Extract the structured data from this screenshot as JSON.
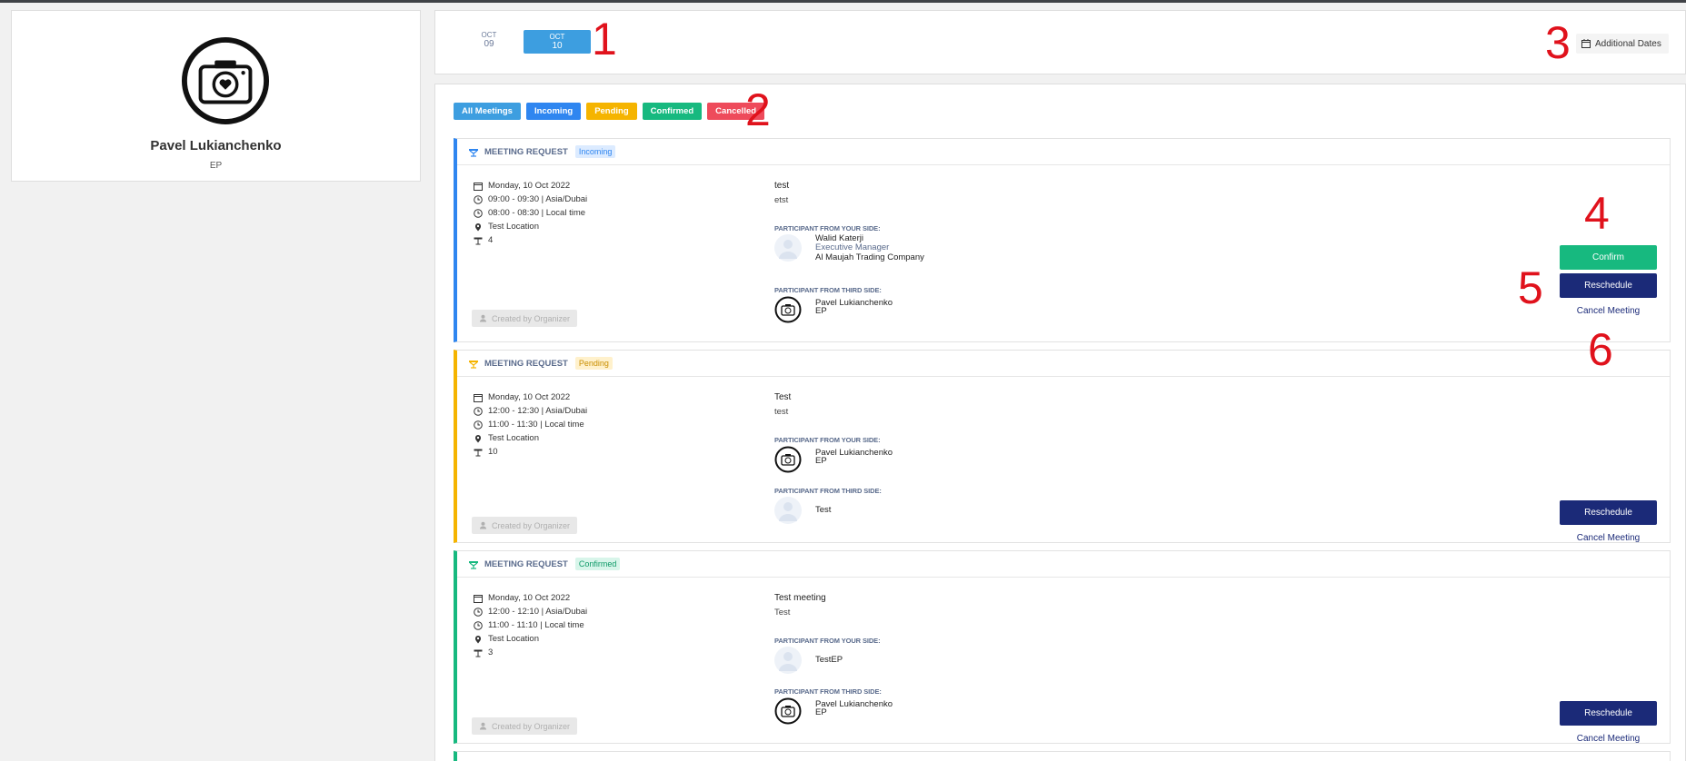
{
  "profile": {
    "name": "Pavel Lukianchenko",
    "role": "EP",
    "avatar_icon": "camera-heart-icon"
  },
  "dates": [
    {
      "month": "OCT",
      "day": "09",
      "selected": false
    },
    {
      "month": "OCT",
      "day": "10",
      "selected": true
    }
  ],
  "additional_dates_label": "Additional Dates",
  "annotations": [
    "1",
    "2",
    "3",
    "4",
    "5",
    "6"
  ],
  "filters": [
    {
      "label": "All Meetings",
      "color": "#3d9ee0"
    },
    {
      "label": "Incoming",
      "color": "#2f86f0"
    },
    {
      "label": "Pending",
      "color": "#f5b400"
    },
    {
      "label": "Confirmed",
      "color": "#17b97f"
    },
    {
      "label": "Cancelled",
      "color": "#ee4b5b"
    }
  ],
  "meetings": [
    {
      "title": "MEETING REQUEST",
      "status": "Incoming",
      "accent": "#2f86f0",
      "date": "Monday, 10 Oct 2022",
      "time_tz": "09:00 - 09:30 | Asia/Dubai",
      "time_local": "08:00 - 08:30 | Local time",
      "location": "Test Location",
      "table": "4",
      "subject": "test",
      "description": "etst",
      "your_side_label": "PARTICIPANT FROM YOUR SIDE:",
      "your_side": {
        "name": "Walid Katerji",
        "role": "Executive Manager",
        "company": "Al Maujah Trading Company"
      },
      "third_side_label": "PARTICIPANT FROM THIRD SIDE:",
      "third_side": {
        "name": "Pavel Lukianchenko",
        "role": "EP"
      },
      "created_label": "Created by Organizer",
      "confirm_label": "Confirm",
      "reschedule_label": "Reschedule",
      "cancel_label": "Cancel Meeting"
    },
    {
      "title": "MEETING REQUEST",
      "status": "Pending",
      "accent": "#f5b400",
      "date": "Monday, 10 Oct 2022",
      "time_tz": "12:00 - 12:30 | Asia/Dubai",
      "time_local": "11:00 - 11:30 | Local time",
      "location": "Test Location",
      "table": "10",
      "subject": "Test",
      "description": "test",
      "your_side_label": "PARTICIPANT FROM YOUR SIDE:",
      "your_side": {
        "name": "Pavel Lukianchenko",
        "role": "EP"
      },
      "third_side_label": "PARTICIPANT FROM THIRD SIDE:",
      "third_side": {
        "name": "Test"
      },
      "created_label": "Created by Organizer",
      "reschedule_label": "Reschedule",
      "cancel_label": "Cancel Meeting"
    },
    {
      "title": "MEETING REQUEST",
      "status": "Confirmed",
      "accent": "#17b97f",
      "date": "Monday, 10 Oct 2022",
      "time_tz": "12:00 - 12:10 | Asia/Dubai",
      "time_local": "11:00 - 11:10 | Local time",
      "location": "Test Location",
      "table": "3",
      "subject": "Test meeting",
      "description": "Test",
      "your_side_label": "PARTICIPANT FROM YOUR SIDE:",
      "your_side": {
        "name": "TestEP"
      },
      "third_side_label": "PARTICIPANT FROM THIRD SIDE:",
      "third_side": {
        "name": "Pavel Lukianchenko",
        "role": "EP"
      },
      "created_label": "Created by Organizer",
      "reschedule_label": "Reschedule",
      "cancel_label": "Cancel Meeting"
    }
  ]
}
